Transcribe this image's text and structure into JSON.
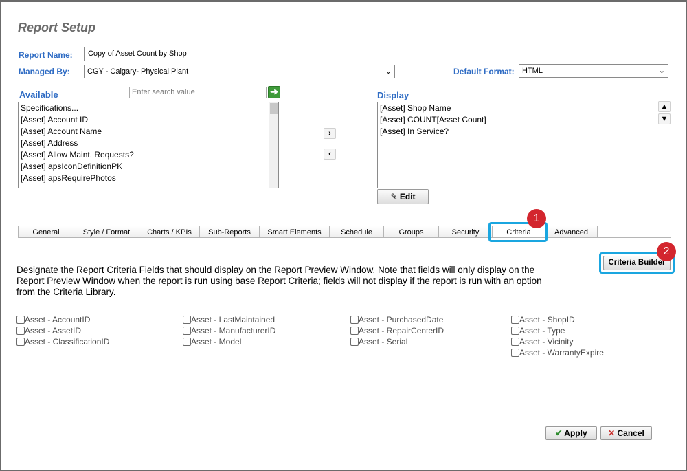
{
  "title": "Report Setup",
  "report_name": {
    "label": "Report Name:",
    "value": "Copy of Asset Count by Shop"
  },
  "managed_by": {
    "label": "Managed By:",
    "value": "CGY - Calgary- Physical Plant"
  },
  "default_format": {
    "label": "Default Format:",
    "value": "HTML"
  },
  "available": {
    "label": "Available",
    "search_placeholder": "Enter search value",
    "items": [
      "Specifications...",
      "[Asset] Account ID",
      "[Asset] Account Name",
      "[Asset] Address",
      "[Asset] Allow Maint. Requests?",
      "[Asset] apsIconDefinitionPK",
      "[Asset] apsRequirePhotos"
    ]
  },
  "display": {
    "label": "Display",
    "items": [
      "[Asset] Shop Name",
      "[Asset] COUNT[Asset Count]",
      "[Asset] In Service?"
    ],
    "edit_label": "Edit"
  },
  "tabs": [
    "General",
    "Style / Format",
    "Charts / KPIs",
    "Sub-Reports",
    "Smart Elements",
    "Schedule",
    "Groups",
    "Security",
    "Criteria",
    "Advanced"
  ],
  "active_tab": "Criteria",
  "criteria_builder_label": "Criteria Builder",
  "badges": [
    "1",
    "2"
  ],
  "description": "Designate the Report Criteria Fields that should display on the Report Preview Window. Note that fields will only display on the Report Preview Window when the report is run using base Report Criteria; fields will not display if the report is run with an option from the Criteria Library.",
  "criteria_fields": {
    "col1": [
      "Asset - AccountID",
      "Asset - AssetID",
      "Asset - ClassificationID"
    ],
    "col2": [
      "Asset - LastMaintained",
      "Asset - ManufacturerID",
      "Asset - Model"
    ],
    "col3": [
      "Asset - PurchasedDate",
      "Asset - RepairCenterID",
      "Asset - Serial"
    ],
    "col4": [
      "Asset - ShopID",
      "Asset - Type",
      "Asset - Vicinity",
      "Asset - WarrantyExpire"
    ]
  },
  "footer": {
    "apply_label": "Apply",
    "cancel_label": "Cancel"
  },
  "colors": {
    "label_blue": "#2f6cc4",
    "highlight": "#1aa6e0",
    "badge_red": "#d3262e"
  }
}
